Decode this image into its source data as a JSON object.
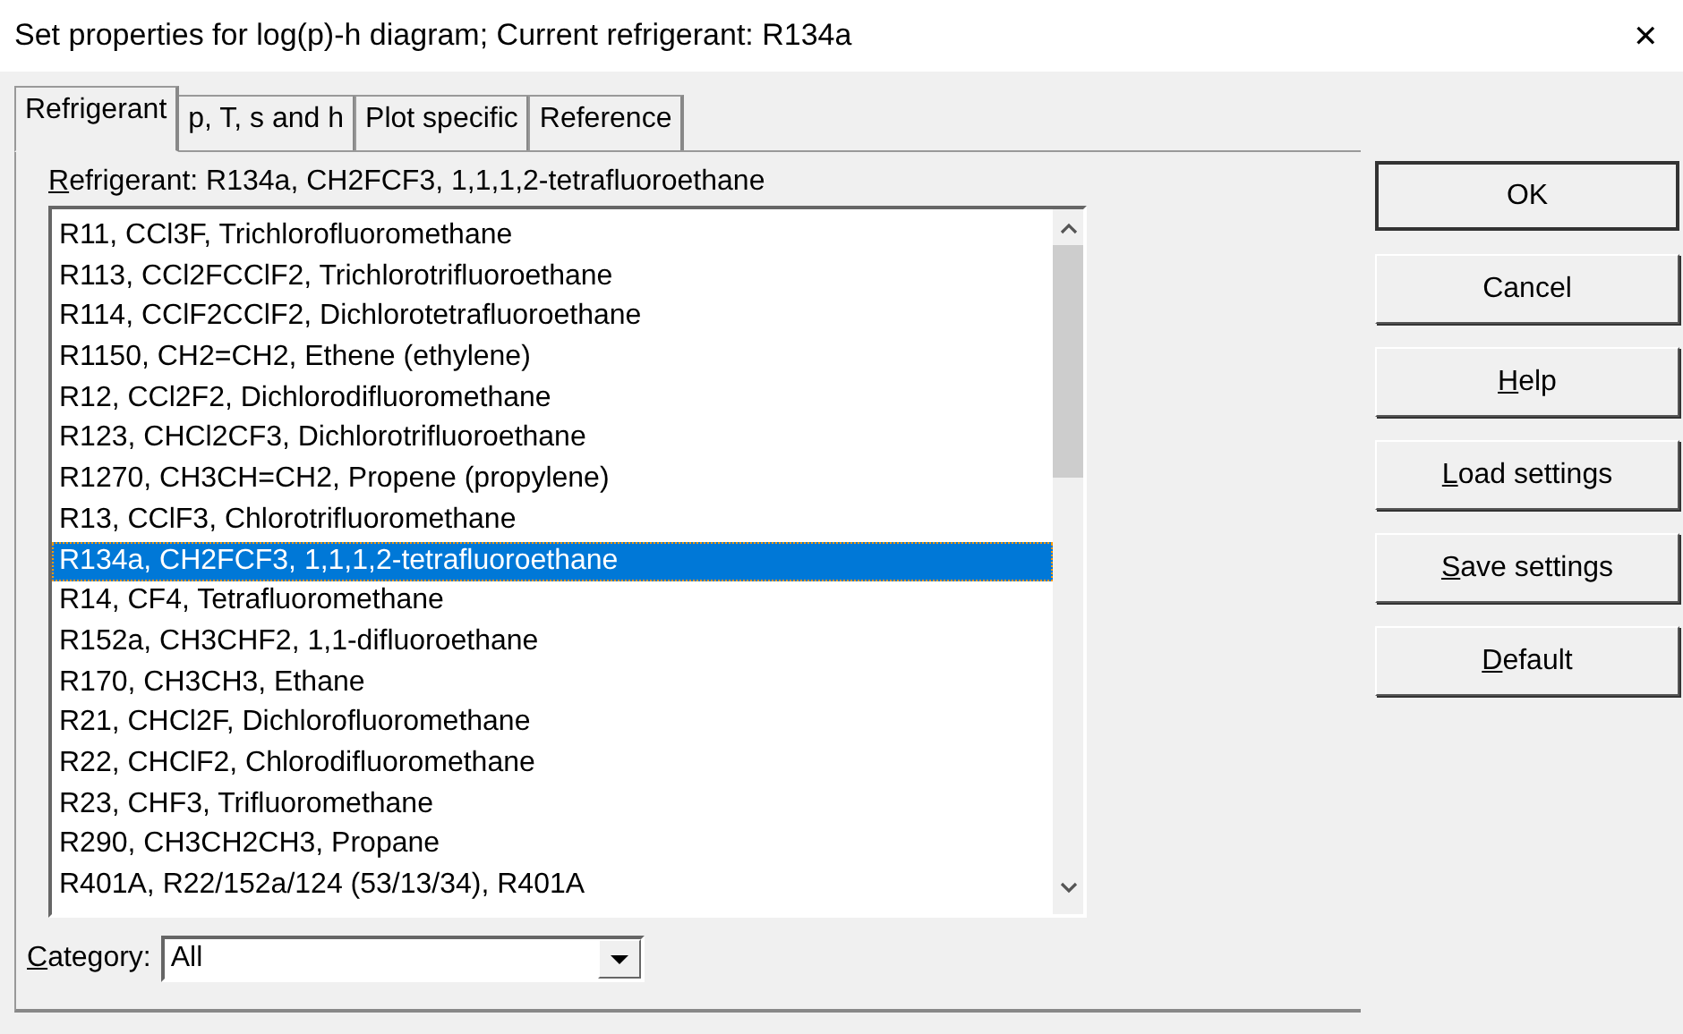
{
  "window": {
    "title": "Set properties for log(p)-h diagram; Current refrigerant: R134a",
    "close": "✕"
  },
  "tabs": [
    {
      "label": "Refrigerant",
      "selected": true
    },
    {
      "label": "p, T, s and h",
      "selected": false
    },
    {
      "label": "Plot specific",
      "selected": false
    },
    {
      "label": "Reference",
      "selected": false
    }
  ],
  "refrigerant_label": {
    "key": "R",
    "rest": "efrigerant:  R134a, CH2FCF3, 1,1,1,2-tetrafluoroethane"
  },
  "refrigerant_list": [
    {
      "label": "R11, CCl3F, Trichlorofluoromethane",
      "selected": false
    },
    {
      "label": "R113, CCl2FCClF2, Trichlorotrifluoroethane",
      "selected": false
    },
    {
      "label": "R114, CClF2CClF2, Dichlorotetrafluoroethane",
      "selected": false
    },
    {
      "label": "R1150, CH2=CH2, Ethene (ethylene)",
      "selected": false
    },
    {
      "label": "R12, CCl2F2, Dichlorodifluoromethane",
      "selected": false
    },
    {
      "label": "R123, CHCl2CF3, Dichlorotrifluoroethane",
      "selected": false
    },
    {
      "label": "R1270, CH3CH=CH2, Propene (propylene)",
      "selected": false
    },
    {
      "label": "R13, CClF3, Chlorotrifluoromethane",
      "selected": false
    },
    {
      "label": "R134a, CH2FCF3, 1,1,1,2-tetrafluoroethane",
      "selected": true
    },
    {
      "label": "R14, CF4, Tetrafluoromethane",
      "selected": false
    },
    {
      "label": "R152a, CH3CHF2, 1,1-difluoroethane",
      "selected": false
    },
    {
      "label": "R170, CH3CH3, Ethane",
      "selected": false
    },
    {
      "label": "R21, CHCl2F, Dichlorofluoromethane",
      "selected": false
    },
    {
      "label": "R22, CHClF2, Chlorodifluoromethane",
      "selected": false
    },
    {
      "label": "R23, CHF3, Trifluoromethane",
      "selected": false
    },
    {
      "label": "R290, CH3CH2CH3, Propane",
      "selected": false
    },
    {
      "label": "R401A, R22/152a/124 (53/13/34), R401A",
      "selected": false
    }
  ],
  "category": {
    "label_key": "C",
    "label_rest": "ategory:",
    "value": "All"
  },
  "buttons": [
    {
      "rest": "OK",
      "default": true
    },
    {
      "rest": "Cancel",
      "default": false
    },
    {
      "key": "H",
      "rest": "elp",
      "default": false
    },
    {
      "key": "L",
      "rest": "oad settings",
      "default": false
    },
    {
      "key": "S",
      "rest": "ave settings",
      "default": false
    },
    {
      "key": "D",
      "rest": "efault",
      "default": false
    }
  ]
}
